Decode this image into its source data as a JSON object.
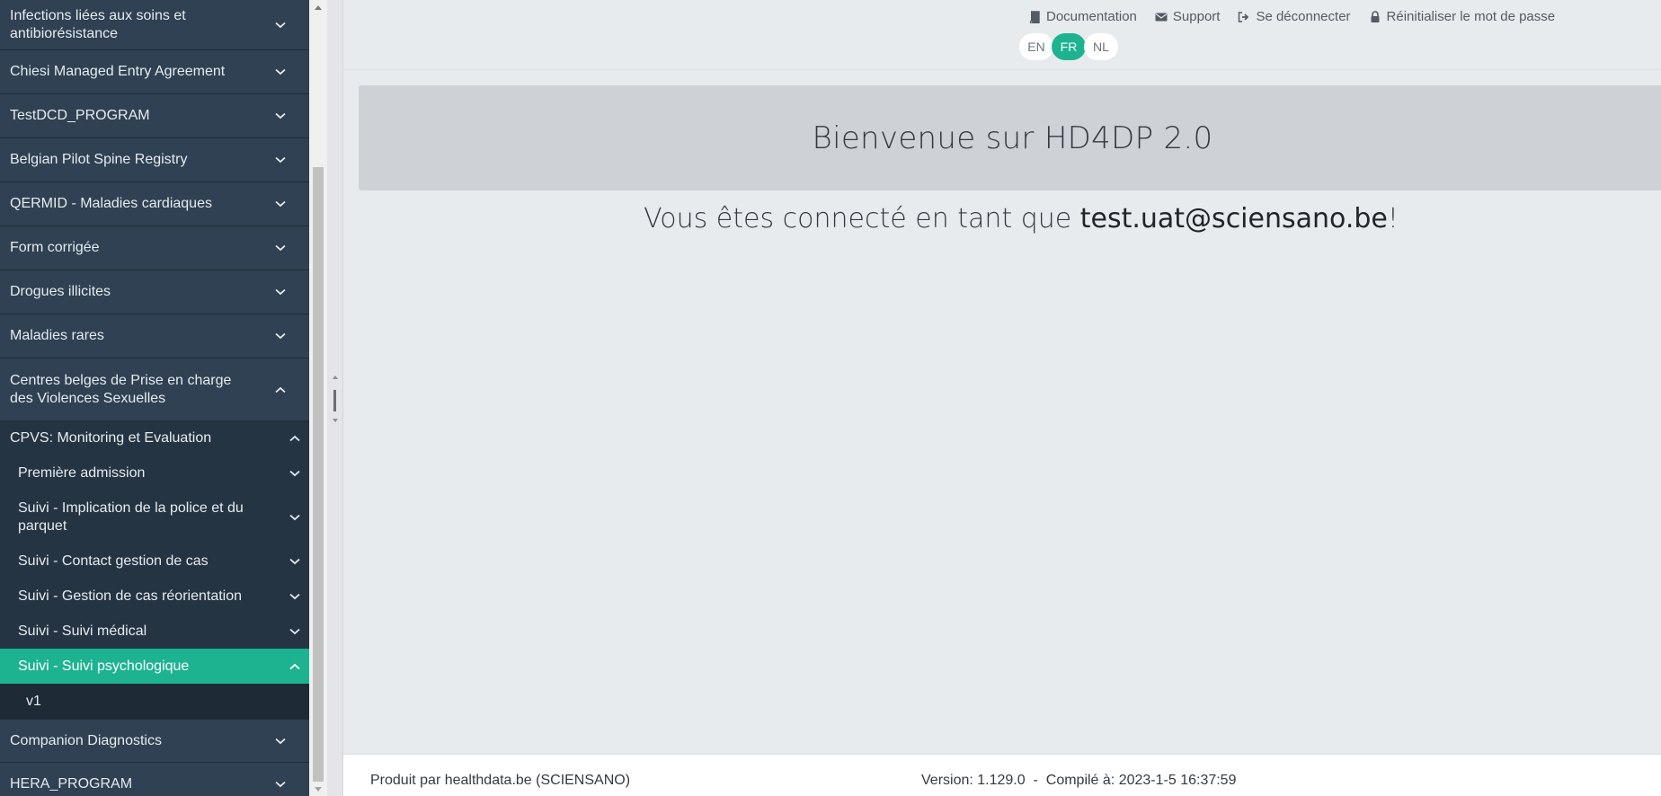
{
  "sidebar": {
    "items": [
      {
        "label": "Infections liées aux soins et antibiorésistance",
        "expanded": false
      },
      {
        "label": "Chiesi Managed Entry Agreement",
        "expanded": false
      },
      {
        "label": "TestDCD_PROGRAM",
        "expanded": false
      },
      {
        "label": "Belgian Pilot Spine Registry",
        "expanded": false
      },
      {
        "label": "QERMID - Maladies cardiaques",
        "expanded": false
      },
      {
        "label": "Form corrigée",
        "expanded": false
      },
      {
        "label": "Drogues illicites",
        "expanded": false
      },
      {
        "label": "Maladies rares",
        "expanded": false
      },
      {
        "label": "Centres belges de Prise en charge des Violences Sexuelles",
        "expanded": true
      },
      {
        "label": "Companion Diagnostics",
        "expanded": false
      },
      {
        "label": "HERA_PROGRAM",
        "expanded": false
      }
    ],
    "sub_project": {
      "label": "CPVS: Monitoring et Evaluation",
      "expanded": true
    },
    "forms": [
      {
        "label": "Première admission"
      },
      {
        "label": "Suivi - Implication de la police et du parquet"
      },
      {
        "label": "Suivi - Contact gestion de cas"
      },
      {
        "label": "Suivi - Gestion de cas réorientation"
      },
      {
        "label": "Suivi - Suivi médical"
      },
      {
        "label": "Suivi - Suivi psychologique",
        "active": true
      }
    ],
    "versions": [
      {
        "label": "v1"
      }
    ]
  },
  "header": {
    "links": {
      "documentation": "Documentation",
      "support": "Support",
      "logout": "Se déconnecter",
      "reset_password": "Réinitialiser le mot de passe"
    },
    "languages": [
      "EN",
      "FR",
      "NL"
    ],
    "selected_language": "FR"
  },
  "main": {
    "welcome": "Bienvenue sur HD4DP 2.0",
    "connected_prefix": "Vous êtes connecté en tant que ",
    "user_email": "test.uat@sciensano.be",
    "connected_suffix": "!"
  },
  "footer": {
    "produced_by": "Produit par healthdata.be (SCIENSANO)",
    "version_label": "Version:",
    "version": "1.129.0",
    "separator": "-",
    "compiled_label": "Compilé à:",
    "compiled": "2023-1-5 16:37:59"
  },
  "colors": {
    "accent": "#1db391",
    "sidebar_bg": "#2f4152",
    "main_bg": "#e8ebee"
  }
}
